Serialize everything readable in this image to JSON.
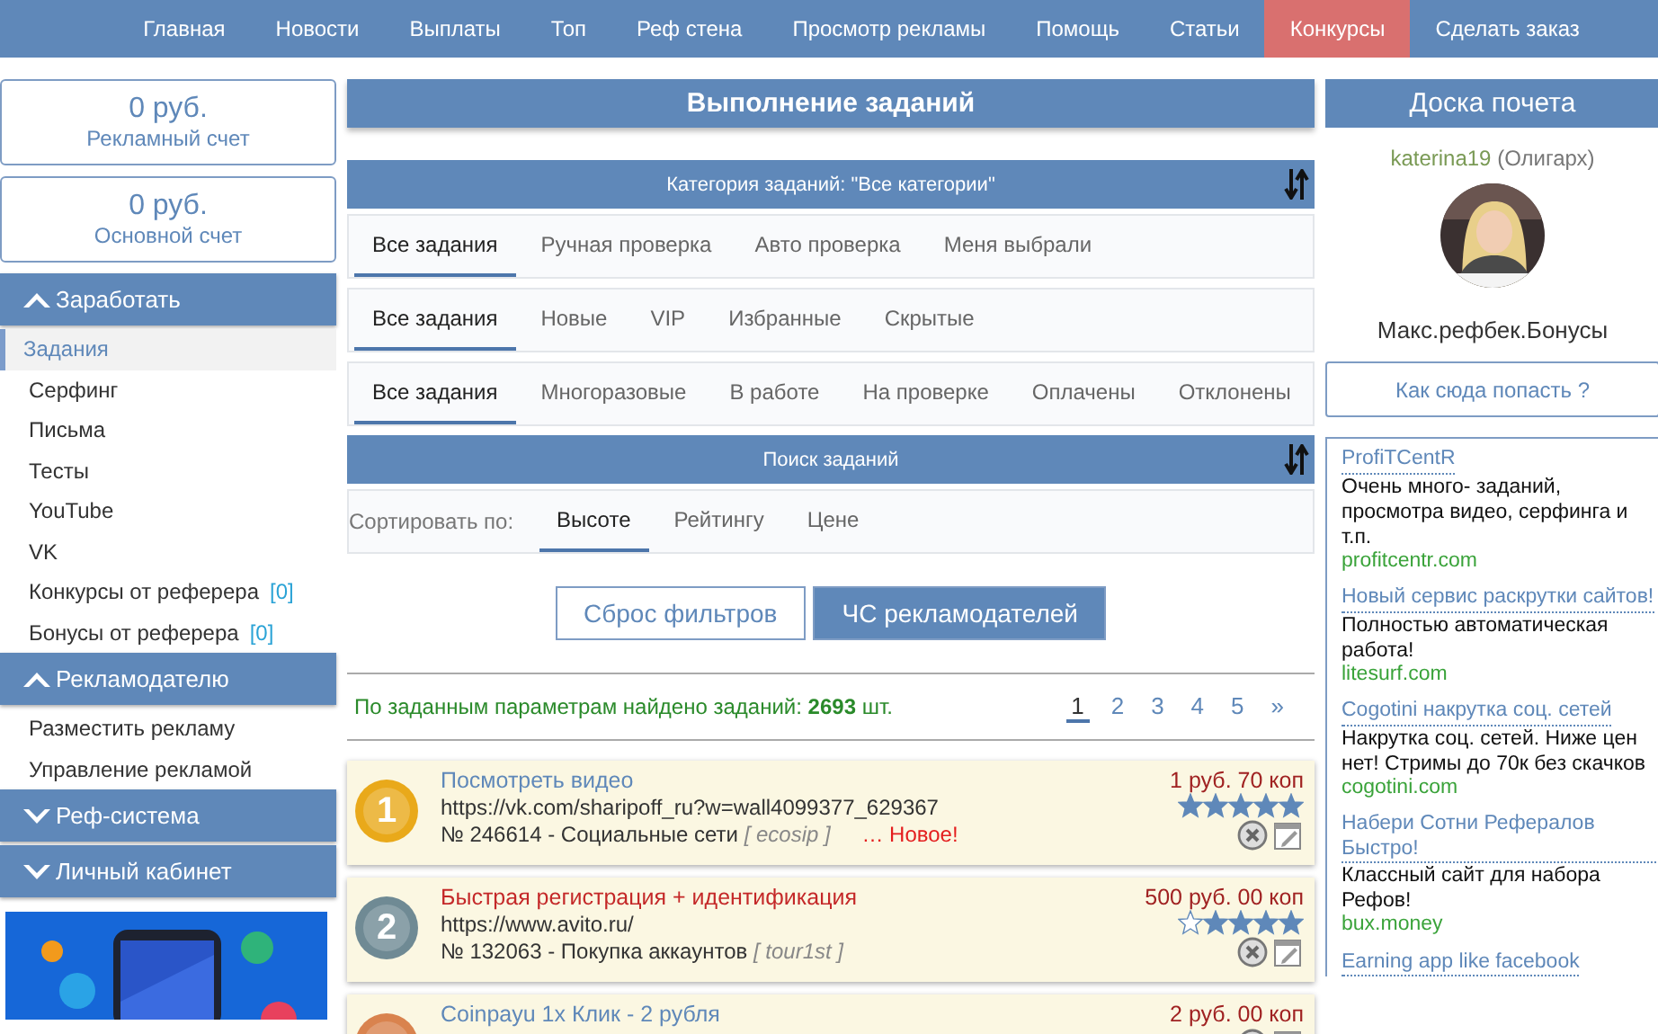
{
  "nav": [
    {
      "label": "Главная",
      "selected": false
    },
    {
      "label": "Новости",
      "selected": false
    },
    {
      "label": "Выплаты",
      "selected": false
    },
    {
      "label": "Топ",
      "selected": false
    },
    {
      "label": "Реф стена",
      "selected": false
    },
    {
      "label": "Просмотр рекламы",
      "selected": false
    },
    {
      "label": "Помощь",
      "selected": false
    },
    {
      "label": "Статьи",
      "selected": false
    },
    {
      "label": "Конкурсы",
      "selected": true
    },
    {
      "label": "Сделать заказ",
      "selected": false
    }
  ],
  "accounts": [
    {
      "amount": "0 руб.",
      "label": "Рекламный счет"
    },
    {
      "amount": "0 руб.",
      "label": "Основной счет"
    }
  ],
  "sidebar": [
    {
      "title": "Заработать",
      "expanded": true,
      "items": [
        {
          "label": "Задания",
          "selected": true
        },
        {
          "label": "Серфинг",
          "selected": false
        },
        {
          "label": "Письма",
          "selected": false
        },
        {
          "label": "Тесты",
          "selected": false
        },
        {
          "label": "YouTube",
          "selected": false
        },
        {
          "label": "VK",
          "selected": false
        },
        {
          "label": "Конкурсы от реферера",
          "count": "[0]",
          "selected": false
        },
        {
          "label": "Бонусы от реферера",
          "count": "[0]",
          "selected": false
        }
      ]
    },
    {
      "title": "Рекламодателю",
      "expanded": true,
      "items": [
        {
          "label": "Разместить рекламу",
          "selected": false
        },
        {
          "label": "Управление рекламой",
          "selected": false
        }
      ]
    },
    {
      "title": "Реф-система",
      "expanded": false
    },
    {
      "title": "Личный кабинет",
      "expanded": false
    }
  ],
  "main": {
    "title": "Выполнение заданий",
    "category_bar": "Категория заданий: \"Все категории\"",
    "tab_rows": [
      [
        {
          "label": "Все задания",
          "selected": true
        },
        {
          "label": "Ручная проверка",
          "selected": false
        },
        {
          "label": "Авто проверка",
          "selected": false
        },
        {
          "label": "Меня выбрали",
          "selected": false
        }
      ],
      [
        {
          "label": "Все задания",
          "selected": true
        },
        {
          "label": "Новые",
          "selected": false
        },
        {
          "label": "VIP",
          "selected": false
        },
        {
          "label": "Избранные",
          "selected": false
        },
        {
          "label": "Скрытые",
          "selected": false
        }
      ],
      [
        {
          "label": "Все задания",
          "selected": true
        },
        {
          "label": "Многоразовые",
          "selected": false
        },
        {
          "label": "В работе",
          "selected": false
        },
        {
          "label": "На проверке",
          "selected": false
        },
        {
          "label": "Оплачены",
          "selected": false
        },
        {
          "label": "Отклонены",
          "selected": false
        }
      ]
    ],
    "search_bar": "Поиск заданий",
    "sort": {
      "label": "Сортировать по:",
      "options": [
        {
          "label": "Высоте",
          "selected": true
        },
        {
          "label": "Рейтингу",
          "selected": false
        },
        {
          "label": "Цене",
          "selected": false
        }
      ]
    },
    "buttons": [
      {
        "label": "Сброс фильтров",
        "kind": "outline"
      },
      {
        "label": "ЧС рекламодателей",
        "kind": "primary"
      }
    ],
    "found": {
      "text": "По заданным параметрам найдено заданий: **2693** шт."
    },
    "pages": [
      {
        "label": "1",
        "selected": true
      },
      {
        "label": "2",
        "selected": false
      },
      {
        "label": "3",
        "selected": false
      },
      {
        "label": "4",
        "selected": false
      },
      {
        "label": "5",
        "selected": false
      },
      {
        "label": "»",
        "selected": false
      }
    ],
    "tasks": [
      {
        "rank": "1",
        "color": "#e9a91a",
        "title": "Посмотреть видео",
        "highlighted": false,
        "url": "https://vk.com/sharipoff_ru?w=wall4099377_629367",
        "info": "№ 246614 - Социальные сети",
        "author": "[ ecosip ]",
        "badge": "… Новое!",
        "price": "1 руб. 70 коп",
        "stars": 5
      },
      {
        "rank": "2",
        "color": "#6f8a94",
        "title": "Быстрая регистрация + идентификация",
        "highlighted": true,
        "url": "https://www.avito.ru/",
        "info": "№ 132063 - Покупка аккаунтов",
        "author": "[ tour1st ]",
        "price": "500 руб. 00 коп",
        "stars": 4
      },
      {
        "color": "#d9834e",
        "title": "Coinpayu 1x Клик - 2 рубля",
        "highlighted": false,
        "price": "2 руб. 00 коп"
      }
    ]
  },
  "right": {
    "title": "Доска почета",
    "user": "katerina19",
    "rank": "(Олигарх)",
    "tagline": "Макс.рефбек.Бонусы",
    "button": "Как сюда попасть ?",
    "ads": [
      {
        "title": "ProfiTCentR",
        "text": "Очень много- заданий, просмотра видео, серфинга и т.п.",
        "domain": "profitcentr.com"
      },
      {
        "title": "Новый сервис раскрутки сайтов!",
        "text": "Полностью автоматическая работа!",
        "domain": "litesurf.com"
      },
      {
        "title": "Cogotini накрутка соц. сетей",
        "text": "Накрутка соц. сетей. Ниже цен нет! Стримы до 70к без скачков",
        "domain": "cogotini.com"
      },
      {
        "title": "Набери Сотни Рефералов Быстро!",
        "text": "Классный сайт для набора Рефов!",
        "domain": "bux.money"
      },
      {
        "title": "Earning app like facebook"
      }
    ]
  }
}
